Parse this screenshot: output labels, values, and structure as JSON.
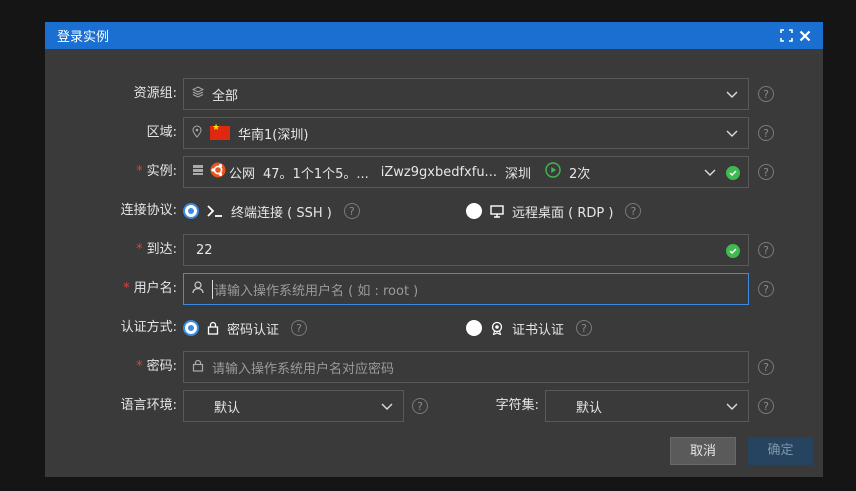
{
  "dialog": {
    "title": "登录实例",
    "maximize_icon": "maximize-icon",
    "close_icon": "close-icon"
  },
  "resource_group": {
    "label": "资源组:",
    "value": "全部",
    "icon": "layers-icon"
  },
  "region": {
    "label": "区域:",
    "value": "华南1(深圳)",
    "icon": "location-pin-icon"
  },
  "instance": {
    "label": "实例:",
    "os_name": "公网",
    "ip": "47。1个1个5。...",
    "instance_id": "iZwz9gxbedfxfu...",
    "city": "深圳",
    "count": "2次",
    "status_color": "#3fb950"
  },
  "protocol": {
    "label": "连接协议:",
    "options": [
      {
        "label": "终端连接 ( SSH )",
        "selected": true,
        "icon": "terminal-icon"
      },
      {
        "label": "远程桌面 ( RDP )",
        "selected": false,
        "icon": "monitor-icon"
      }
    ]
  },
  "port": {
    "label": "到达:",
    "value": "22"
  },
  "username": {
    "label": "用户名:",
    "placeholder": "请输入操作系统用户名 ( 如 : root )"
  },
  "auth": {
    "label": "认证方式:",
    "options": [
      {
        "label": "密码认证",
        "selected": true,
        "icon": "lock-icon"
      },
      {
        "label": "证书认证",
        "selected": false,
        "icon": "certificate-icon"
      }
    ]
  },
  "password": {
    "label": "密码:",
    "placeholder": "请输入操作系统用户名对应密码"
  },
  "locale": {
    "label": "语言环境:",
    "value": "默认"
  },
  "charset": {
    "label": "字符集:",
    "value": "默认"
  },
  "buttons": {
    "cancel": "取消",
    "ok": "确定"
  },
  "colors": {
    "accent": "#1a6fd1",
    "required": "#e04040",
    "success": "#3fb950"
  }
}
